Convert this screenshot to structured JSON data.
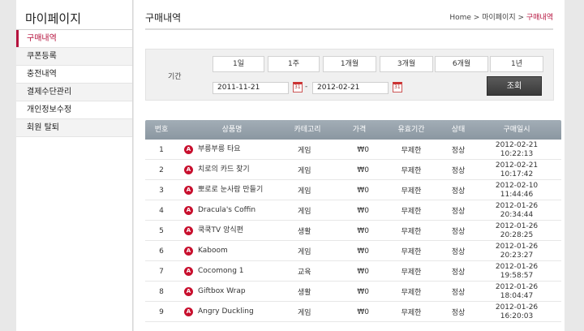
{
  "sidebar": {
    "title": "마이페이지",
    "items": [
      {
        "label": "구매내역"
      },
      {
        "label": "쿠폰등록"
      },
      {
        "label": "충전내역"
      },
      {
        "label": "결제수단관리"
      },
      {
        "label": "개인정보수정"
      },
      {
        "label": "회원 탈퇴"
      }
    ]
  },
  "header": {
    "title": "구매내역",
    "breadcrumb": {
      "home": "Home",
      "sep1": " > ",
      "parent": "마이페이지",
      "sep2": " > ",
      "current": "구매내역"
    }
  },
  "filter": {
    "label": "기간",
    "periods": [
      "1일",
      "1주",
      "1개월",
      "3개월",
      "6개월",
      "1년"
    ],
    "start_date": "2011-11-21",
    "end_date": "2012-02-21",
    "dash": "-",
    "search_label": "조회"
  },
  "table": {
    "headers": [
      "번호",
      "상품명",
      "카테고리",
      "가격",
      "유효기간",
      "상태",
      "구매일시"
    ],
    "rows": [
      {
        "no": "1",
        "name": "부릉부릉 타요",
        "category": "게임",
        "price": "₩0",
        "period": "무제한",
        "status": "정상",
        "date": "2012-02-21",
        "time": "10:22:13"
      },
      {
        "no": "2",
        "name": "치로의 카드 찾기",
        "category": "게임",
        "price": "₩0",
        "period": "무제한",
        "status": "정상",
        "date": "2012-02-21",
        "time": "10:17:42"
      },
      {
        "no": "3",
        "name": "뽀로로 눈사람 만들기",
        "category": "게임",
        "price": "₩0",
        "period": "무제한",
        "status": "정상",
        "date": "2012-02-10",
        "time": "11:44:46"
      },
      {
        "no": "4",
        "name": "Dracula's Coffin",
        "category": "게임",
        "price": "₩0",
        "period": "무제한",
        "status": "정상",
        "date": "2012-01-26",
        "time": "20:34:44"
      },
      {
        "no": "5",
        "name": "쿡쿡TV 앙식편",
        "category": "생활",
        "price": "₩0",
        "period": "무제한",
        "status": "정상",
        "date": "2012-01-26",
        "time": "20:28:25"
      },
      {
        "no": "6",
        "name": "Kaboom",
        "category": "게임",
        "price": "₩0",
        "period": "무제한",
        "status": "정상",
        "date": "2012-01-26",
        "time": "20:23:27"
      },
      {
        "no": "7",
        "name": "Cocomong 1",
        "category": "교육",
        "price": "₩0",
        "period": "무제한",
        "status": "정상",
        "date": "2012-01-26",
        "time": "19:58:57"
      },
      {
        "no": "8",
        "name": "Giftbox Wrap",
        "category": "생활",
        "price": "₩0",
        "period": "무제한",
        "status": "정상",
        "date": "2012-01-26",
        "time": "18:04:47"
      },
      {
        "no": "9",
        "name": "Angry Duckling",
        "category": "게임",
        "price": "₩0",
        "period": "무제한",
        "status": "정상",
        "date": "2012-01-26",
        "time": "16:20:03"
      }
    ],
    "app_badge": "A"
  },
  "colors": {
    "accent": "#b5123d",
    "app_icon": "#c8102e",
    "search_button": "#444444"
  }
}
